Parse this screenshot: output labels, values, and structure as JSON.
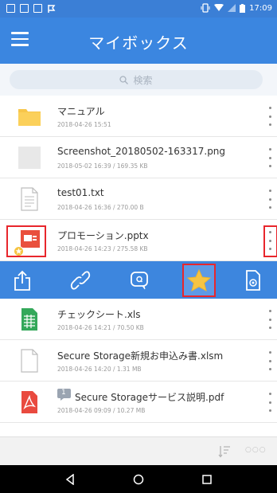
{
  "status_bar": {
    "time": "17:09"
  },
  "app_bar": {
    "title": "マイボックス"
  },
  "search": {
    "placeholder": "検索"
  },
  "files": [
    {
      "name": "マニュアル",
      "meta": "2018-04-26 15:51",
      "icon": "folder-icon"
    },
    {
      "name": "Screenshot_20180502-163317.png",
      "meta": "2018-05-02 16:39 / 169.35 KB",
      "icon": "image-file-icon"
    },
    {
      "name": "test01.txt",
      "meta": "2018-04-26 16:36 / 270.00 B",
      "icon": "text-file-icon"
    },
    {
      "name": "プロモーション.pptx",
      "meta": "2018-04-26 14:23 / 275.58 KB",
      "icon": "pptx-file-icon",
      "favorite": true
    },
    {
      "name": "チェックシート.xls",
      "meta": "2018-04-26 14:21 / 70.50 KB",
      "icon": "xls-file-icon"
    },
    {
      "name": "Secure Storage新規お申込み書.xlsm",
      "meta": "2018-04-26 14:20 / 1.31 MB",
      "icon": "generic-file-icon"
    },
    {
      "name": "Secure Storageサービス説明.pdf",
      "meta": "2018-04-26 09:09 / 10.27 MB",
      "icon": "pdf-file-icon",
      "comment_badge": "1"
    }
  ],
  "actions": [
    "share-icon",
    "link-icon",
    "comment-icon",
    "favorite-star-icon",
    "file-info-icon"
  ],
  "toolbar": {
    "pager_dots": "○○○"
  },
  "colors": {
    "primary": "#3b86e0",
    "highlight": "#e8262c",
    "star": "#f6c443"
  }
}
